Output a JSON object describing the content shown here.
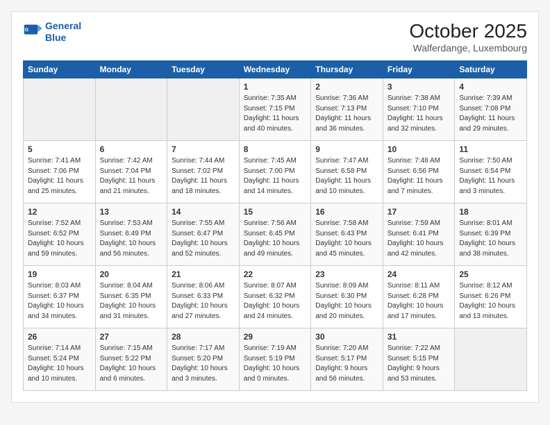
{
  "header": {
    "logo_line1": "General",
    "logo_line2": "Blue",
    "month": "October 2025",
    "location": "Walferdange, Luxembourg"
  },
  "days_of_week": [
    "Sunday",
    "Monday",
    "Tuesday",
    "Wednesday",
    "Thursday",
    "Friday",
    "Saturday"
  ],
  "weeks": [
    [
      {
        "num": "",
        "info": ""
      },
      {
        "num": "",
        "info": ""
      },
      {
        "num": "",
        "info": ""
      },
      {
        "num": "1",
        "info": "Sunrise: 7:35 AM\nSunset: 7:15 PM\nDaylight: 11 hours\nand 40 minutes."
      },
      {
        "num": "2",
        "info": "Sunrise: 7:36 AM\nSunset: 7:13 PM\nDaylight: 11 hours\nand 36 minutes."
      },
      {
        "num": "3",
        "info": "Sunrise: 7:38 AM\nSunset: 7:10 PM\nDaylight: 11 hours\nand 32 minutes."
      },
      {
        "num": "4",
        "info": "Sunrise: 7:39 AM\nSunset: 7:08 PM\nDaylight: 11 hours\nand 29 minutes."
      }
    ],
    [
      {
        "num": "5",
        "info": "Sunrise: 7:41 AM\nSunset: 7:06 PM\nDaylight: 11 hours\nand 25 minutes."
      },
      {
        "num": "6",
        "info": "Sunrise: 7:42 AM\nSunset: 7:04 PM\nDaylight: 11 hours\nand 21 minutes."
      },
      {
        "num": "7",
        "info": "Sunrise: 7:44 AM\nSunset: 7:02 PM\nDaylight: 11 hours\nand 18 minutes."
      },
      {
        "num": "8",
        "info": "Sunrise: 7:45 AM\nSunset: 7:00 PM\nDaylight: 11 hours\nand 14 minutes."
      },
      {
        "num": "9",
        "info": "Sunrise: 7:47 AM\nSunset: 6:58 PM\nDaylight: 11 hours\nand 10 minutes."
      },
      {
        "num": "10",
        "info": "Sunrise: 7:48 AM\nSunset: 6:56 PM\nDaylight: 11 hours\nand 7 minutes."
      },
      {
        "num": "11",
        "info": "Sunrise: 7:50 AM\nSunset: 6:54 PM\nDaylight: 11 hours\nand 3 minutes."
      }
    ],
    [
      {
        "num": "12",
        "info": "Sunrise: 7:52 AM\nSunset: 6:52 PM\nDaylight: 10 hours\nand 59 minutes."
      },
      {
        "num": "13",
        "info": "Sunrise: 7:53 AM\nSunset: 6:49 PM\nDaylight: 10 hours\nand 56 minutes."
      },
      {
        "num": "14",
        "info": "Sunrise: 7:55 AM\nSunset: 6:47 PM\nDaylight: 10 hours\nand 52 minutes."
      },
      {
        "num": "15",
        "info": "Sunrise: 7:56 AM\nSunset: 6:45 PM\nDaylight: 10 hours\nand 49 minutes."
      },
      {
        "num": "16",
        "info": "Sunrise: 7:58 AM\nSunset: 6:43 PM\nDaylight: 10 hours\nand 45 minutes."
      },
      {
        "num": "17",
        "info": "Sunrise: 7:59 AM\nSunset: 6:41 PM\nDaylight: 10 hours\nand 42 minutes."
      },
      {
        "num": "18",
        "info": "Sunrise: 8:01 AM\nSunset: 6:39 PM\nDaylight: 10 hours\nand 38 minutes."
      }
    ],
    [
      {
        "num": "19",
        "info": "Sunrise: 8:03 AM\nSunset: 6:37 PM\nDaylight: 10 hours\nand 34 minutes."
      },
      {
        "num": "20",
        "info": "Sunrise: 8:04 AM\nSunset: 6:35 PM\nDaylight: 10 hours\nand 31 minutes."
      },
      {
        "num": "21",
        "info": "Sunrise: 8:06 AM\nSunset: 6:33 PM\nDaylight: 10 hours\nand 27 minutes."
      },
      {
        "num": "22",
        "info": "Sunrise: 8:07 AM\nSunset: 6:32 PM\nDaylight: 10 hours\nand 24 minutes."
      },
      {
        "num": "23",
        "info": "Sunrise: 8:09 AM\nSunset: 6:30 PM\nDaylight: 10 hours\nand 20 minutes."
      },
      {
        "num": "24",
        "info": "Sunrise: 8:11 AM\nSunset: 6:28 PM\nDaylight: 10 hours\nand 17 minutes."
      },
      {
        "num": "25",
        "info": "Sunrise: 8:12 AM\nSunset: 6:26 PM\nDaylight: 10 hours\nand 13 minutes."
      }
    ],
    [
      {
        "num": "26",
        "info": "Sunrise: 7:14 AM\nSunset: 5:24 PM\nDaylight: 10 hours\nand 10 minutes."
      },
      {
        "num": "27",
        "info": "Sunrise: 7:15 AM\nSunset: 5:22 PM\nDaylight: 10 hours\nand 6 minutes."
      },
      {
        "num": "28",
        "info": "Sunrise: 7:17 AM\nSunset: 5:20 PM\nDaylight: 10 hours\nand 3 minutes."
      },
      {
        "num": "29",
        "info": "Sunrise: 7:19 AM\nSunset: 5:19 PM\nDaylight: 10 hours\nand 0 minutes."
      },
      {
        "num": "30",
        "info": "Sunrise: 7:20 AM\nSunset: 5:17 PM\nDaylight: 9 hours\nand 56 minutes."
      },
      {
        "num": "31",
        "info": "Sunrise: 7:22 AM\nSunset: 5:15 PM\nDaylight: 9 hours\nand 53 minutes."
      },
      {
        "num": "",
        "info": ""
      }
    ]
  ]
}
